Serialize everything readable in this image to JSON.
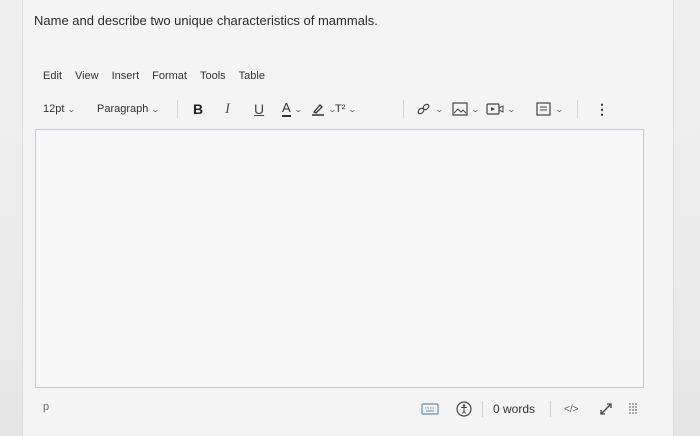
{
  "question": "Name and describe two unique characteristics of mammals.",
  "menu": [
    "Edit",
    "View",
    "Insert",
    "Format",
    "Tools",
    "Table"
  ],
  "toolbar": {
    "font_size": "12pt",
    "block_format": "Paragraph",
    "bold": "B",
    "italic": "I",
    "underline": "U",
    "text_color": "A",
    "superscript": "T²",
    "more": "⋮"
  },
  "editor": {
    "content": ""
  },
  "status": {
    "path": "p",
    "word_count": "0 words",
    "code_view": "</>"
  },
  "icons": {
    "highlight": "pencil-icon",
    "link": "link-icon",
    "image": "image-icon",
    "media": "media-icon",
    "document": "document-icon",
    "keyboard": "keyboard-icon",
    "accessibility": "accessibility-icon",
    "fullscreen": "expand-icon",
    "resize": "resize-grip-icon"
  }
}
